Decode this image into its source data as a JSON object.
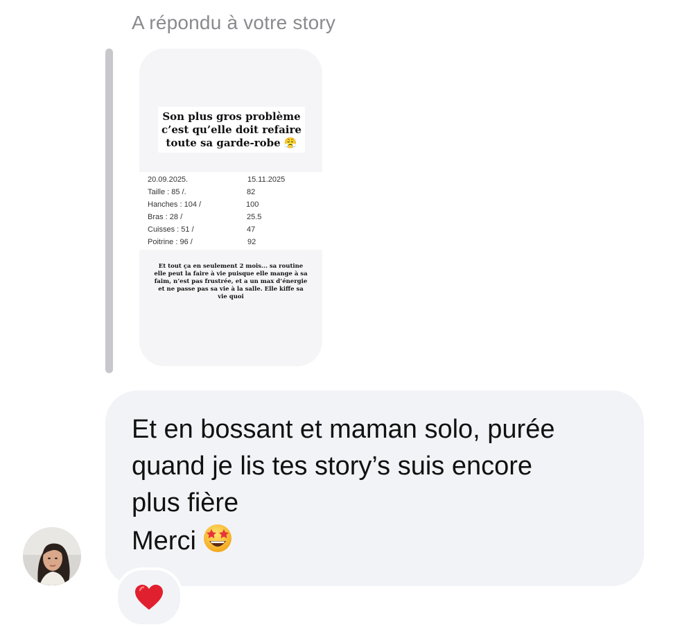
{
  "reply_label": "A répondu à votre story",
  "story": {
    "headline": "Son plus gros problème\nc’est qu’elle doit refaire\ntoute sa garde-robe 😤",
    "measurements": [
      {
        "left": "20.09.2025.",
        "right": "15.11.2025"
      },
      {
        "left": "Taille : 85 /.",
        "right": "82"
      },
      {
        "left": "Hanches : 104 /",
        "right": "100"
      },
      {
        "left": "Bras : 28  /",
        "right": "25.5"
      },
      {
        "left": "Cuisses : 51 /",
        "right": "47"
      },
      {
        "left": "Poitrine : 96 /",
        "right": "92"
      }
    ],
    "caption": "Et tout ça en seulement 2 mois... sa routine elle peut la faire à vie puisque elle mange à sa faim, n’est pas frustrée, et a un max d’énergie et ne passe pas sa vie à la salle. Elle kiffe sa vie quoi"
  },
  "message": {
    "lines": [
      "Et en bossant et maman solo, purée",
      "quand je lis tes story’s suis encore",
      "plus fière",
      "Merci"
    ],
    "emoji": "star-struck-emoji"
  },
  "reaction": {
    "emoji": "❤️"
  },
  "colors": {
    "bubble": "#f2f3f6",
    "label": "#8a8a8e",
    "reply_bar": "#c7c7cc",
    "heart": "#e0202e"
  }
}
